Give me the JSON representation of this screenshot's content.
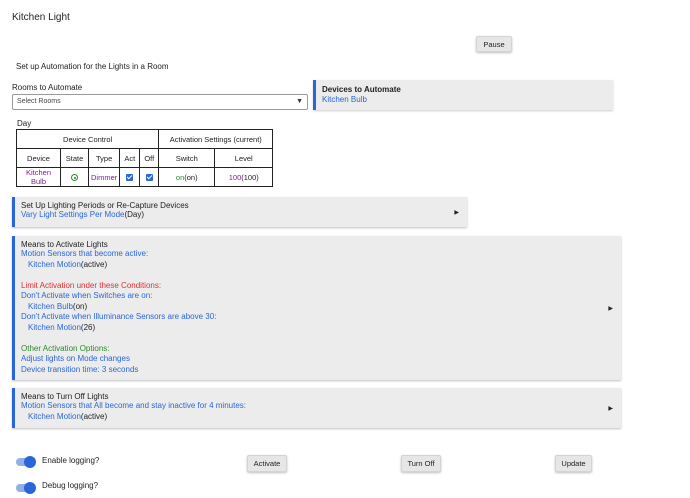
{
  "page": {
    "title": "Kitchen Light"
  },
  "buttons": {
    "pause": "Pause",
    "activate": "Activate",
    "turn_off": "Turn Off",
    "update": "Update"
  },
  "setup": {
    "heading": "Set up Automation for the Lights in a Room"
  },
  "rooms": {
    "label": "Rooms to Automate",
    "value": "Select Rooms",
    "caret_icon": "chevron-down-icon"
  },
  "devices": {
    "heading": "Devices to Automate",
    "value": "Kitchen Bulb"
  },
  "day": {
    "label": "Day"
  },
  "table": {
    "group_device_control": "Device Control",
    "group_activation": "Activation Settings (current)",
    "headers": [
      "Device",
      "State",
      "Type",
      "Act",
      "Off",
      "Switch",
      "Level"
    ],
    "row": {
      "device": "Kitchen Bulb",
      "state_icon": "radio-on-icon",
      "type": "Dimmer",
      "act_checked": true,
      "off_checked": true,
      "switch_val": "on",
      "switch_cur": "(on)",
      "level_val": "100",
      "level_cur": "(100)"
    }
  },
  "periods": {
    "heading": "Set Up Lighting Periods or Re-Capture Devices",
    "value": "Vary Light Settings Per Mode",
    "value_suffix": "(Day)"
  },
  "activate": {
    "heading": "Means to Activate Lights",
    "motion_label": "Motion Sensors that become active:",
    "motion_device": "Kitchen Motion",
    "motion_device_state": "(active)",
    "limit_label": "Limit Activation under these Conditions:",
    "switch_label": "Don't Activate when Switches are on:",
    "switch_device": "Kitchen Bulb",
    "switch_device_state": "(on)",
    "lux_label": "Don't Activate when Illuminance Sensors are above 30:",
    "lux_device": "Kitchen Motion",
    "lux_device_state": "(26)",
    "other_label": "Other Activation Options:",
    "other_1": "Adjust lights on Mode changes",
    "other_2": "Device transition time: 3 seconds"
  },
  "turnoff": {
    "heading": "Means to Turn Off Lights",
    "motion_label": "Motion Sensors that All become and stay inactive for 4 minutes:",
    "motion_device": "Kitchen Motion",
    "motion_device_state": "(active)"
  },
  "logging": {
    "enable_label": "Enable logging?",
    "enable_on": true,
    "debug_label": "Debug logging?",
    "debug_on": true
  },
  "colors": {
    "accent": "#2a66d9",
    "device": "#7a1f8a",
    "ok": "#2b8a2b",
    "warn": "#e03030"
  }
}
